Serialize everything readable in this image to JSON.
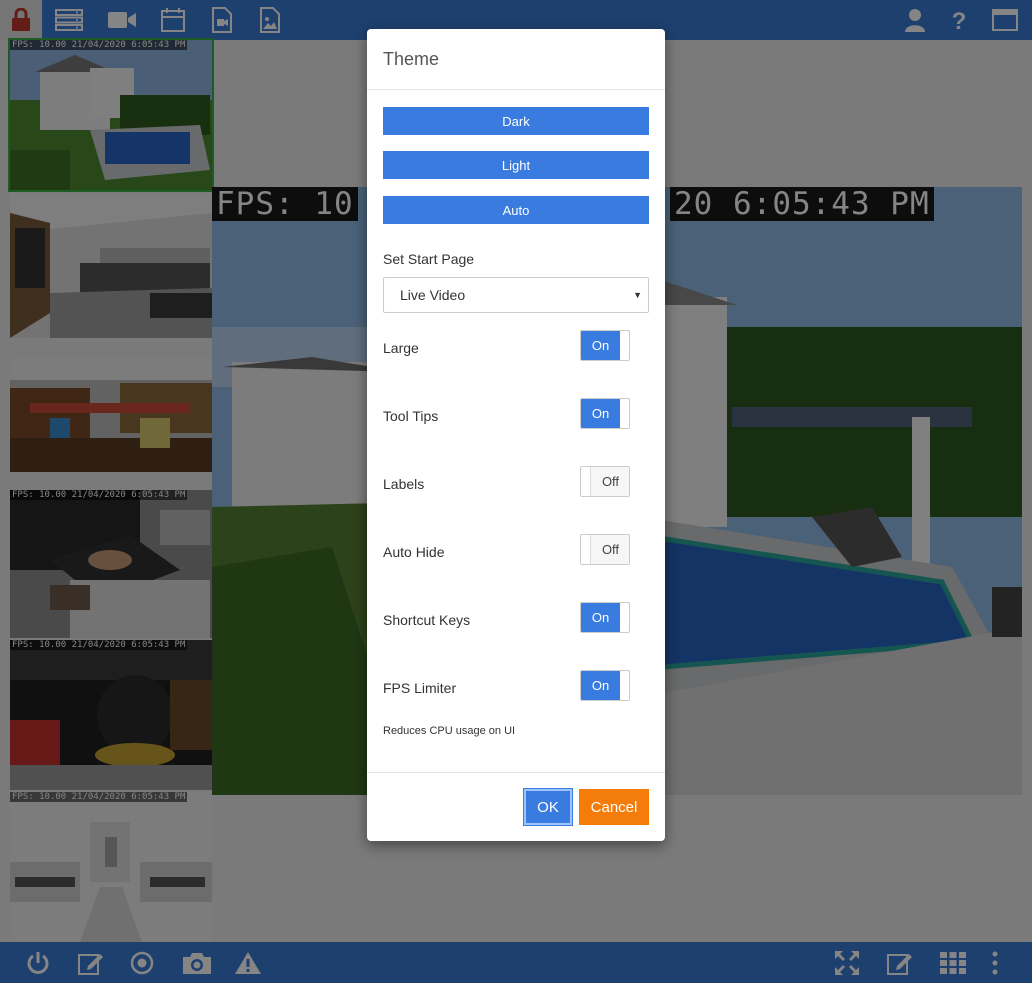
{
  "thumbnails": [
    {
      "osd": "FPS: 10.00 21/04/2020 6:05:43 PM",
      "selected": true
    },
    {
      "osd": ""
    },
    {
      "osd": ""
    },
    {
      "osd": "FPS: 10.00 21/04/2020 6:05:43 PM"
    },
    {
      "osd": "FPS: 10.00 21/04/2020 6:05:43 PM"
    },
    {
      "osd": "FPS: 10.00 21/04/2020 6:05:43 PM"
    }
  ],
  "main_view": {
    "osd_left": "FPS: 10",
    "osd_right": "20 6:05:43 PM"
  },
  "modal": {
    "title": "Theme",
    "theme_buttons": [
      "Dark",
      "Light",
      "Auto"
    ],
    "start_page_label": "Set Start Page",
    "start_page_value": "Live Video",
    "toggles": [
      {
        "label": "Large",
        "state": "On"
      },
      {
        "label": "Tool Tips",
        "state": "On"
      },
      {
        "label": "Labels",
        "state": "Off"
      },
      {
        "label": "Auto Hide",
        "state": "Off"
      },
      {
        "label": "Shortcut Keys",
        "state": "On"
      },
      {
        "label": "FPS Limiter",
        "state": "On"
      }
    ],
    "hint": "Reduces CPU usage on UI",
    "ok_label": "OK",
    "cancel_label": "Cancel"
  },
  "colors": {
    "accent": "#3a7be0",
    "bar": "#3a7bd5",
    "cancel": "#f47c0a",
    "selected_thumb": "#3cb043"
  },
  "icons": {
    "top": [
      "lock-icon",
      "server-icon",
      "video-camera-icon",
      "calendar-icon",
      "video-file-icon",
      "image-file-icon",
      "user-icon",
      "help-icon",
      "window-icon"
    ],
    "bottom": [
      "power-icon",
      "edit-icon",
      "record-icon",
      "camera-icon",
      "warning-icon",
      "fullscreen-icon",
      "edit-layout-icon",
      "grid-icon",
      "more-icon"
    ]
  }
}
